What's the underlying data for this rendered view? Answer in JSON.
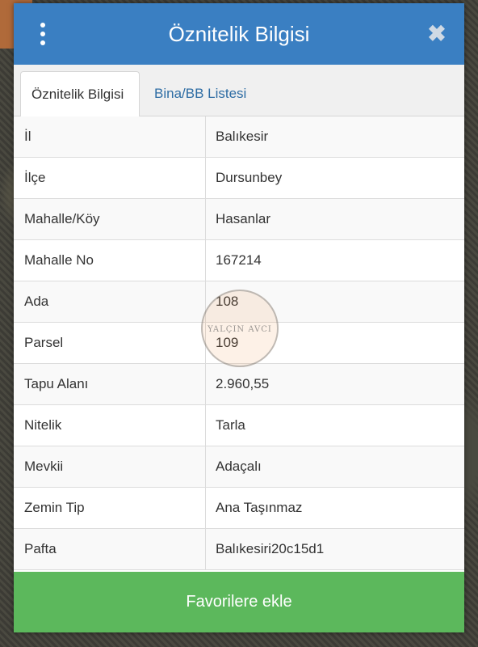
{
  "header": {
    "title": "Öznitelik Bilgisi"
  },
  "tabs": [
    {
      "label": "Öznitelik Bilgisi",
      "active": true
    },
    {
      "label": "Bina/BB Listesi",
      "active": false
    }
  ],
  "rows": [
    {
      "key": "İl",
      "value": "Balıkesir"
    },
    {
      "key": "İlçe",
      "value": "Dursunbey"
    },
    {
      "key": "Mahalle/Köy",
      "value": "Hasanlar"
    },
    {
      "key": "Mahalle No",
      "value": "167214"
    },
    {
      "key": "Ada",
      "value": "108"
    },
    {
      "key": "Parsel",
      "value": "109"
    },
    {
      "key": "Tapu Alanı",
      "value": "2.960,55"
    },
    {
      "key": "Nitelik",
      "value": "Tarla"
    },
    {
      "key": "Mevkii",
      "value": "Adaçalı"
    },
    {
      "key": "Zemin Tip",
      "value": "Ana Taşınmaz"
    },
    {
      "key": "Pafta",
      "value": "Balıkesiri20c15d1"
    }
  ],
  "footer": {
    "favorite_label": "Favorilere ekle"
  },
  "watermark": {
    "text": "YALÇIN AVCI"
  },
  "colors": {
    "header": "#3a7fc2",
    "button": "#5cb85c",
    "link": "#2e6da4"
  }
}
